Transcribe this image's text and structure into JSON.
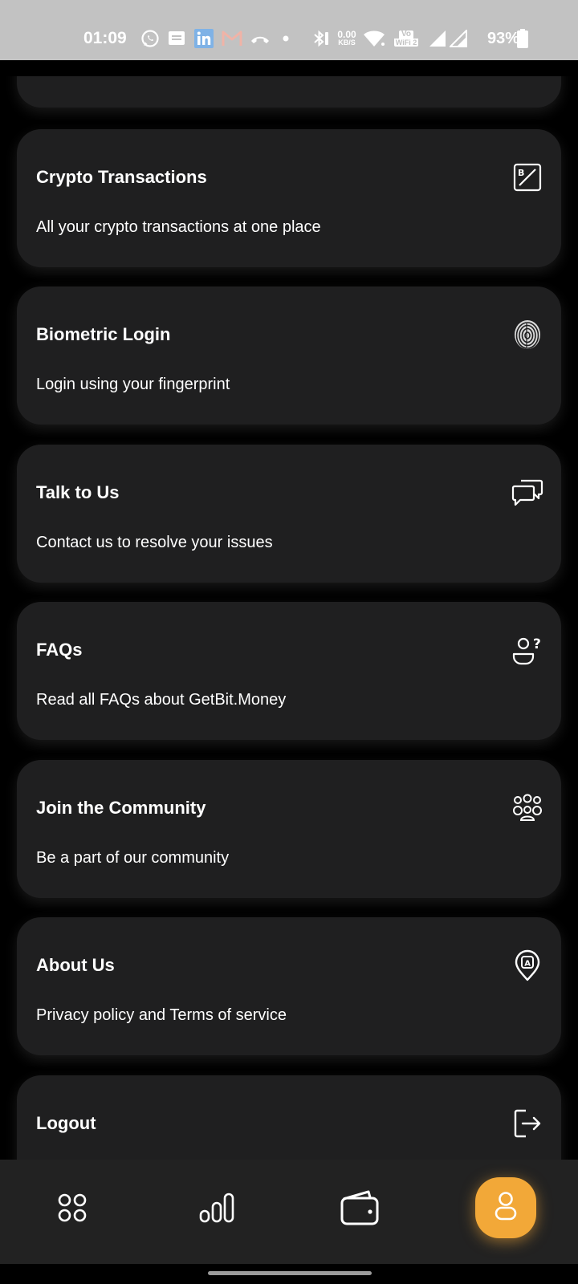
{
  "status_bar": {
    "time": "01:09",
    "network_speed_value": "0.00",
    "network_speed_unit": "KB/S",
    "volte_label": "Vo",
    "wifi_label": "WiFi 2",
    "battery": "93%",
    "notification_icons": [
      "whatsapp-icon",
      "message-icon",
      "linkedin-icon",
      "gmail-icon",
      "missed-call-icon",
      "dot-icon"
    ],
    "system_icons": [
      "bluetooth-icon",
      "wifi-icon",
      "signal-icon",
      "signal-icon",
      "battery-icon"
    ]
  },
  "menu": {
    "items": [
      {
        "title": "",
        "subtitle": "",
        "icon": ""
      },
      {
        "title": "Crypto Transactions",
        "subtitle": "All your crypto transactions at one place",
        "icon": "crypto-transactions-icon"
      },
      {
        "title": "Biometric Login",
        "subtitle": "Login using your fingerprint",
        "icon": "fingerprint-icon"
      },
      {
        "title": "Talk to Us",
        "subtitle": "Contact us to resolve your issues",
        "icon": "chat-icon"
      },
      {
        "title": "FAQs",
        "subtitle": "Read all FAQs about GetBit.Money",
        "icon": "faq-icon"
      },
      {
        "title": "Join the Community",
        "subtitle": "Be a part of our community",
        "icon": "community-icon"
      },
      {
        "title": "About Us",
        "subtitle": "Privacy policy and Terms of service",
        "icon": "about-location-icon"
      },
      {
        "title": "Logout",
        "subtitle": "",
        "icon": "logout-icon"
      }
    ]
  },
  "bottom_nav": {
    "items": [
      {
        "icon": "apps-grid-icon",
        "active": false
      },
      {
        "icon": "stats-icon",
        "active": false
      },
      {
        "icon": "wallet-icon",
        "active": false
      },
      {
        "icon": "profile-icon",
        "active": true
      }
    ],
    "active_color": "#f2a838"
  },
  "colors": {
    "background": "#000000",
    "card": "#1f1f20",
    "status_bar": "#c2c2c2",
    "nav_bar": "#222222",
    "accent": "#f2a838"
  }
}
